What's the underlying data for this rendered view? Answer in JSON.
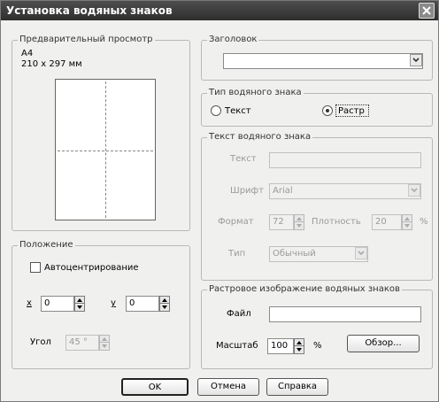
{
  "dialog": {
    "title": "Установка водяных знаков"
  },
  "preview": {
    "legend": "Предварительный просмотр",
    "paper_name": "A4",
    "paper_size": "210 x 297 мм"
  },
  "position": {
    "legend": "Положение",
    "autocenter_label": "Автоцентрирование",
    "autocenter_checked": false,
    "x_label": "x",
    "x_value": "0",
    "y_label": "y",
    "y_value": "0",
    "angle_label": "Угол",
    "angle_value": "45 °"
  },
  "header": {
    "legend": "Заголовок",
    "selected_value": ""
  },
  "watermark_type": {
    "legend": "Тип водяного знака",
    "option_text": "Текст",
    "option_raster": "Растр",
    "selected": "Растр"
  },
  "watermark_text": {
    "legend": "Текст водяного знака",
    "text_label": "Текст",
    "text_value": "",
    "font_label": "Шрифт",
    "font_value": "Arial",
    "size_label": "Формат",
    "size_value": "72",
    "density_label": "Плотность",
    "density_value": "20",
    "percent": "%",
    "type_label": "Тип",
    "type_value": "Обычный"
  },
  "raster": {
    "legend": "Растровое изображение водяных знаков",
    "file_label": "Файл",
    "file_value": "",
    "scale_label": "Масштаб",
    "scale_value": "100",
    "percent": "%",
    "browse_label": "Обзор..."
  },
  "footer": {
    "ok_label": "OK",
    "cancel_label": "Отмена",
    "help_label": "Справка"
  },
  "colors": {
    "titlebar": "#3a3a3a",
    "dialog_bg": "#f0f0ee",
    "disabled_text": "#9a9a9a"
  },
  "icons": [
    "close-icon",
    "dropdown-arrow-icon",
    "spin-up-icon",
    "spin-down-icon",
    "radio-selected-icon"
  ]
}
